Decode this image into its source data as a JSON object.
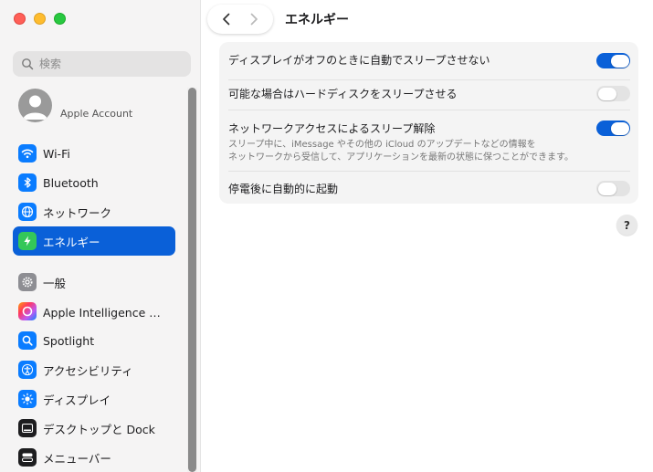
{
  "window": {
    "title": "エネルギー"
  },
  "sidebar": {
    "search_placeholder": "検索",
    "account_label": "Apple Account",
    "items": [
      {
        "label": "Wi-Fi",
        "icon": "wifi-icon",
        "color": "#0a7cff"
      },
      {
        "label": "Bluetooth",
        "icon": "bluetooth-icon",
        "color": "#0a7cff"
      },
      {
        "label": "ネットワーク",
        "icon": "globe-icon",
        "color": "#0a7cff"
      },
      {
        "label": "エネルギー",
        "icon": "bolt-icon",
        "color": "#34c759",
        "selected": true
      },
      {
        "label": "一般",
        "icon": "gear-icon",
        "color": "#8e8e93"
      },
      {
        "label": "Apple Intelligence と…",
        "icon": "apple-intelligence-icon",
        "color": "#ff6b9a"
      },
      {
        "label": "Spotlight",
        "icon": "spotlight-icon",
        "color": "#0a7cff"
      },
      {
        "label": "アクセシビリティ",
        "icon": "accessibility-icon",
        "color": "#0a7cff"
      },
      {
        "label": "ディスプレイ",
        "icon": "display-brightness-icon",
        "color": "#0a7cff"
      },
      {
        "label": "デスクトップと Dock",
        "icon": "dock-icon",
        "color": "#1d1d1f"
      },
      {
        "label": "メニューバー",
        "icon": "menubar-icon",
        "color": "#1d1d1f"
      }
    ]
  },
  "settings": [
    {
      "label": "ディスプレイがオフのときに自動でスリープさせない",
      "on": true,
      "description": ""
    },
    {
      "label": "可能な場合はハードディスクをスリープさせる",
      "on": false,
      "description": ""
    },
    {
      "label": "ネットワークアクセスによるスリープ解除",
      "on": true,
      "description_line1": "スリープ中に、iMessage やその他の iCloud のアップデートなどの情報を",
      "description_line2": "ネットワークから受信して、アプリケーションを最新の状態に保つことができます。"
    },
    {
      "label": "停電後に自動的に起動",
      "on": false,
      "description": ""
    }
  ],
  "help": {
    "label": "?"
  },
  "colors": {
    "accent": "#0a60d8",
    "close": "#ff5f57",
    "minimize": "#febc2e",
    "maximize": "#28c840"
  }
}
